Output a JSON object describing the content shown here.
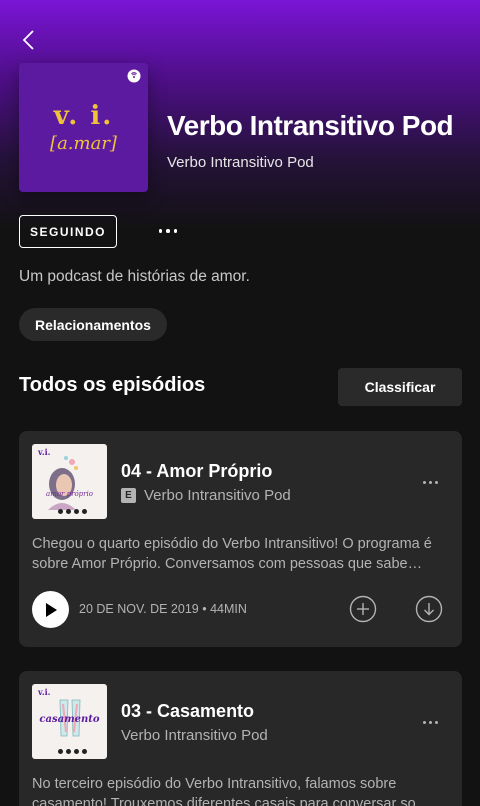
{
  "colors": {
    "background": "#121212",
    "header_gradient_top": "#7a14d6",
    "card": "#282828",
    "cover": "#5c1aa0",
    "cover_text": "#f0c23a"
  },
  "header": {
    "back_icon": "chevron-left-icon",
    "cover": {
      "title": "v. i.",
      "subtitle": "[a.mar]",
      "badge_icon": "podcast-badge-icon"
    },
    "title": "Verbo Intransitivo Pod",
    "author": "Verbo Intransitivo Pod"
  },
  "actions": {
    "follow_label": "SEGUINDO",
    "more_icon": "more-horizontal-icon"
  },
  "description": "Um podcast de histórias de amor.",
  "category_chip": "Relacionamentos",
  "episodes_section": {
    "title": "Todos os episódios",
    "sort_label": "Classificar"
  },
  "episodes": [
    {
      "thumb_label": "amor próprio",
      "thumb_brand": "v.i.",
      "title": "04 - Amor Próprio",
      "explicit_badge": "E",
      "show": "Verbo Intransitivo Pod",
      "description": "Chegou o quarto episódio do Verbo Intransitivo! O programa é sobre Amor Próprio. Conversamos com pessoas que sabe…",
      "date_duration": "20 DE NOV. DE 2019 • 44MIN"
    },
    {
      "thumb_label": "casamento",
      "thumb_brand": "v.i.",
      "title": "03 - Casamento",
      "show": "Verbo Intransitivo Pod",
      "description": "No terceiro episódio do Verbo Intransitivo, falamos sobre casamento! Trouxemos diferentes casais para conversar so…"
    }
  ]
}
